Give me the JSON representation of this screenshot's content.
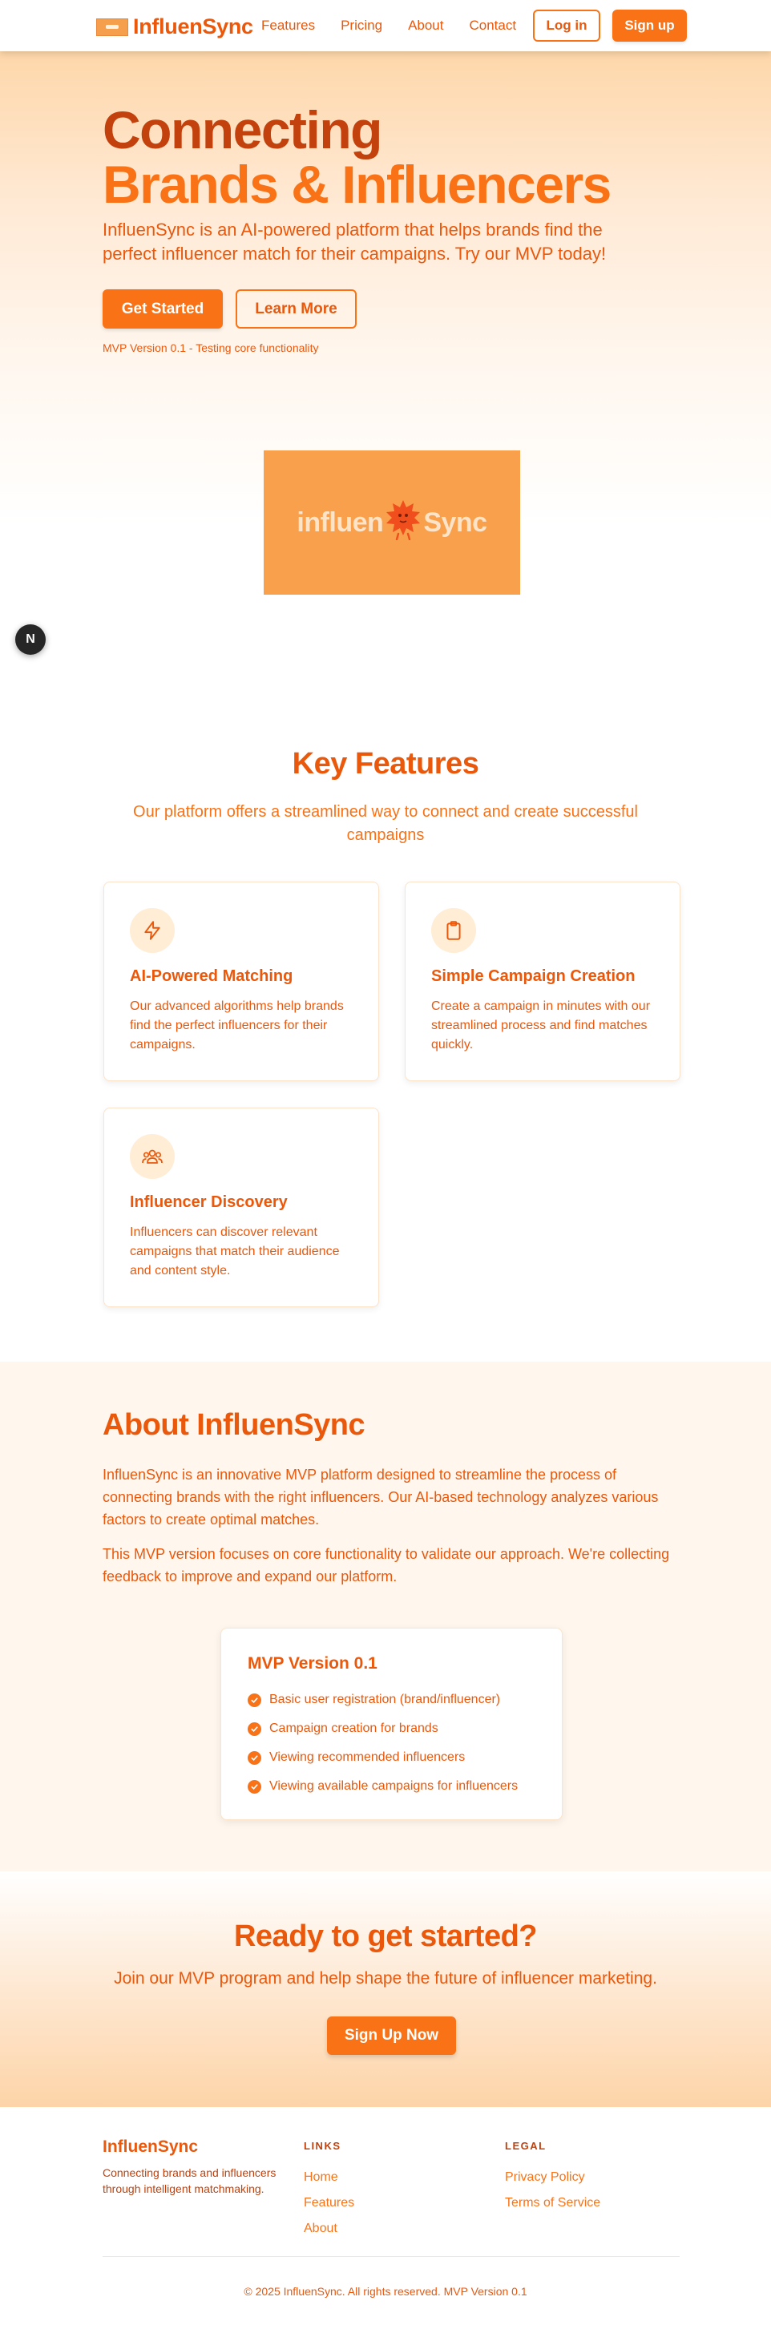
{
  "header": {
    "brand": "InfluenSync",
    "nav": [
      "Features",
      "Pricing",
      "About",
      "Contact"
    ],
    "login_label": "Log in",
    "signup_label": "Sign up"
  },
  "hero": {
    "title_line1": "Connecting",
    "title_line2": "Brands & Influencers",
    "subtitle": "InfluenSync is an AI-powered platform that helps brands find the perfect influencer match for their campaigns. Try our MVP today!",
    "primary_cta": "Get Started",
    "secondary_cta": "Learn More",
    "version_note": "MVP Version 0.1 - Testing core functionality",
    "image_word_left": "influen",
    "image_word_right": "Sync",
    "dev_badge": "N"
  },
  "features": {
    "title": "Key Features",
    "subtitle": "Our platform offers a streamlined way to connect and create successful campaigns",
    "cards": [
      {
        "icon": "lightning-icon",
        "title": "AI-Powered Matching",
        "description": "Our advanced algorithms help brands find the perfect influencers for their campaigns."
      },
      {
        "icon": "clipboard-icon",
        "title": "Simple Campaign Creation",
        "description": "Create a campaign in minutes with our streamlined process and find matches quickly."
      },
      {
        "icon": "users-icon",
        "title": "Influencer Discovery",
        "description": "Influencers can discover relevant campaigns that match their audience and content style."
      }
    ]
  },
  "about": {
    "title": "About InfluenSync",
    "paragraph1": "InfluenSync is an innovative MVP platform designed to streamline the process of connecting brands with the right influencers. Our AI-based technology analyzes various factors to create optimal matches.",
    "paragraph2": "This MVP version focuses on core functionality to validate our approach. We're collecting feedback to improve and expand our platform.",
    "mvp_title": "MVP Version 0.1",
    "mvp_items": [
      "Basic user registration (brand/influencer)",
      "Campaign creation for brands",
      "Viewing recommended influencers",
      "Viewing available campaigns for influencers"
    ]
  },
  "cta": {
    "title": "Ready to get started?",
    "subtitle": "Join our MVP program and help shape the future of influencer marketing.",
    "button": "Sign Up Now"
  },
  "footer": {
    "brand": "InfluenSync",
    "tagline": "Connecting brands and influencers through intelligent matchmaking.",
    "links_heading": "LINKS",
    "links": [
      "Home",
      "Features",
      "About"
    ],
    "legal_heading": "LEGAL",
    "legal": [
      "Privacy Policy",
      "Terms of Service"
    ],
    "copyright": "© 2025 InfluenSync. All rights reserved. MVP Version 0.1"
  },
  "colors": {
    "primary": "#f97316",
    "primary_dark": "#ea580c",
    "deep": "#c2410c",
    "tint": "#ffedd5"
  }
}
